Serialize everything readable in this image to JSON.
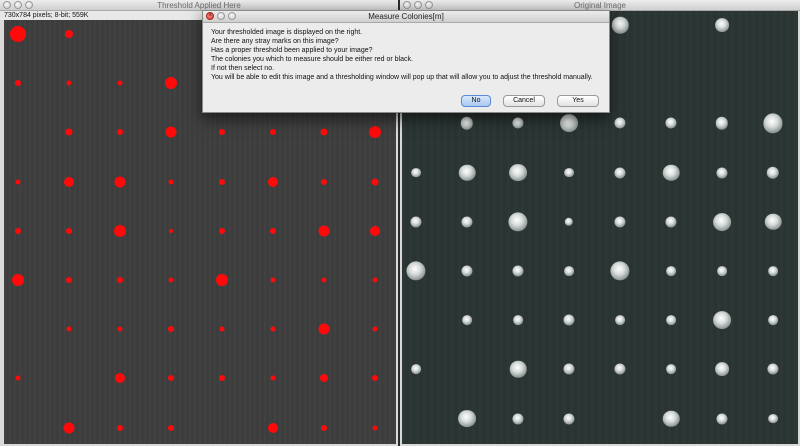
{
  "left_window": {
    "title": "Threshold Applied Here",
    "info": "730x784 pixels; 8-bit; 559K"
  },
  "right_window": {
    "title": "Original Image"
  },
  "dialog": {
    "title": "Measure Colonies[m]",
    "lines": [
      "Your thresholded image is displayed on the right.",
      "Are there any stray marks on this image?",
      "Has a proper threshold been applied to your image?",
      "The colonies you which to measure should be either red or black.",
      "If not then select no.",
      "You will be able to edit this image and a thresholding window will pop up that will allow you to adjust the threshold manually."
    ],
    "buttons": {
      "no": "No",
      "cancel": "Cancel",
      "yes": "Yes"
    }
  },
  "colors": {
    "threshold_red": "#ff0a0a",
    "plate_left": "#3d3d3d",
    "plate_right": "#2a3533"
  }
}
